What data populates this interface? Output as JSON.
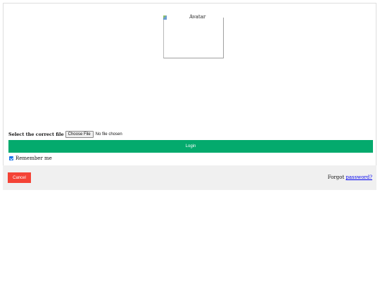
{
  "avatar": {
    "alt": "Avatar"
  },
  "file_input": {
    "label": "Select the correct file",
    "button": "Choose File",
    "status": "No file chosen"
  },
  "login_button": "Login",
  "remember": {
    "label": "Remember me",
    "checked": true
  },
  "footer": {
    "cancel": "Cancel",
    "forgot_prefix": "Forgot",
    "forgot_link": "password?"
  }
}
